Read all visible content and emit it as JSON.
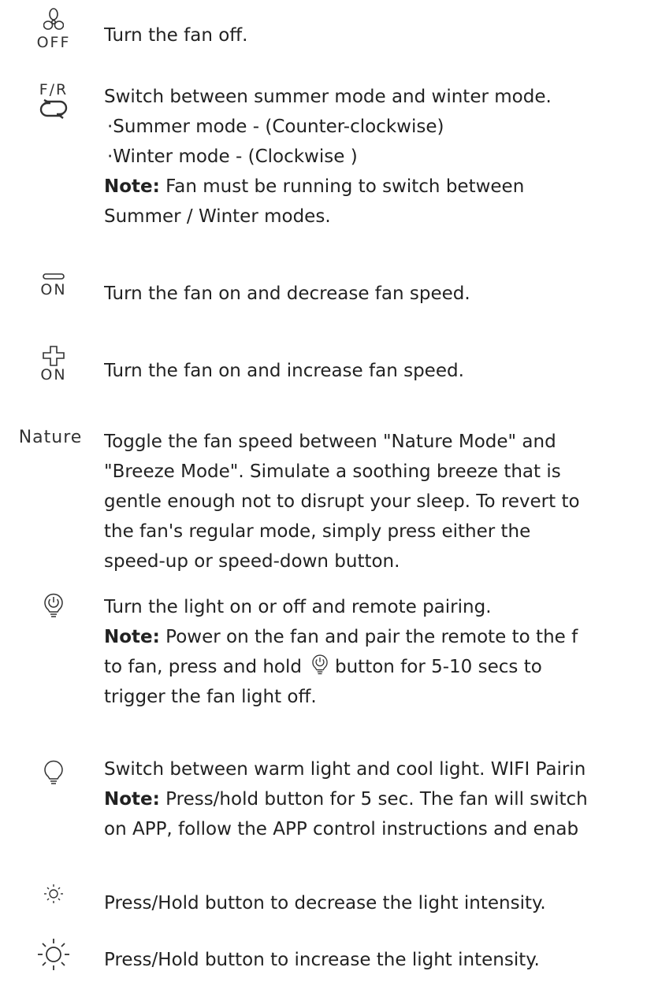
{
  "rows": {
    "off": {
      "icon_label": "OFF",
      "text": "Turn the fan off."
    },
    "fr": {
      "icon_label": "F/R",
      "text": "Switch between summer mode and winter mode.",
      "bullets": [
        "·Summer mode - (Counter-clockwise)",
        "·Winter mode - (Clockwise )"
      ],
      "note_label": "Note:",
      "note_line1": " Fan must be running to switch between",
      "note_line2": "Summer / Winter modes."
    },
    "minus": {
      "icon_label": "ON",
      "text": "Turn the fan on and decrease fan speed."
    },
    "plus": {
      "icon_label": "ON",
      "text": "Turn the fan on and increase fan speed."
    },
    "nature": {
      "icon_label": "Nature",
      "lines": [
        "Toggle the fan speed between \"Nature Mode\" and",
        "\"Breeze Mode\". Simulate a soothing breeze that is",
        "gentle enough not to disrupt your sleep. To revert to",
        "the fan's regular mode, simply press either the",
        "speed-up or speed-down button."
      ]
    },
    "light_power": {
      "text": "Turn the light on or off and remote pairing.",
      "note_label": "Note:",
      "note_line1": " Power on the fan and pair the remote to the f",
      "note_line2a": "to fan, press and hold",
      "note_line2b": "button for 5-10 secs to",
      "note_line3": "trigger the fan light off."
    },
    "light_color": {
      "text": "Switch between warm light and cool light. WIFI Pairin",
      "note_label": "Note:",
      "note_line1": " Press/hold button for 5 sec. The fan will switch",
      "note_line2": "on APP, follow the APP control instructions and enab"
    },
    "dim": {
      "text": "Press/Hold button to decrease the light intensity."
    },
    "bright": {
      "text": "Press/Hold button to increase the light intensity."
    }
  }
}
